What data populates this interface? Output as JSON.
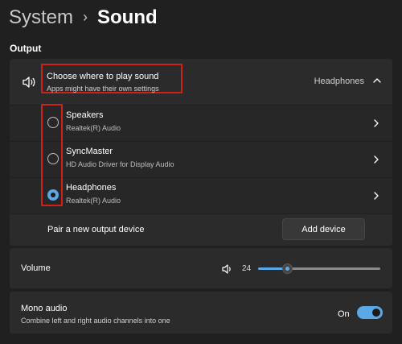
{
  "breadcrumb": {
    "parent": "System",
    "separator": "›",
    "current": "Sound"
  },
  "output": {
    "section_title": "Output",
    "header": {
      "title": "Choose where to play sound",
      "subtitle": "Apps might have their own settings",
      "current_device": "Headphones",
      "icon": "speaker-icon"
    },
    "devices": [
      {
        "name": "Speakers",
        "description": "Realtek(R) Audio",
        "selected": false
      },
      {
        "name": "SyncMaster",
        "description": "HD Audio Driver for Display Audio",
        "selected": false
      },
      {
        "name": "Headphones",
        "description": "Realtek(R) Audio",
        "selected": true
      }
    ],
    "pair": {
      "label": "Pair a new output device",
      "button": "Add device"
    }
  },
  "volume": {
    "label": "Volume",
    "value": "24",
    "level": 0.24
  },
  "mono": {
    "label": "Mono audio",
    "subtitle": "Combine left and right audio channels into one",
    "state": "On",
    "enabled": true
  },
  "colors": {
    "accent": "#5aa8e6",
    "highlight": "#d0201a",
    "background": "#202020",
    "card": "#2b2b2b"
  }
}
